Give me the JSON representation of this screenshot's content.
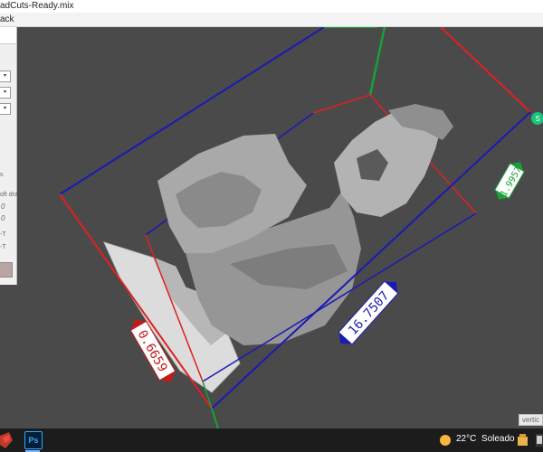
{
  "window": {
    "title": "adCuts-Ready.mix"
  },
  "menu": {
    "partial_label": "ack"
  },
  "left_panel": {
    "lines": [
      "s",
      "oft drag",
      "0",
      "0",
      "-T",
      "-T"
    ]
  },
  "viewport": {
    "dimension_labels": {
      "width": "0.6659",
      "depth": "16.7507",
      "height": "1.9957"
    },
    "gizmo_handle_letter": "S",
    "hint_text": "vertic"
  },
  "taskbar": {
    "apps": [
      {
        "name": "Ps"
      }
    ],
    "weather": {
      "temperature": "22°C",
      "condition": "Soleado"
    }
  },
  "colors": {
    "x_axis": "#e02020",
    "y_axis": "#18a03a",
    "z_axis": "#1a1ab4",
    "gizmo": "#19c37d"
  }
}
